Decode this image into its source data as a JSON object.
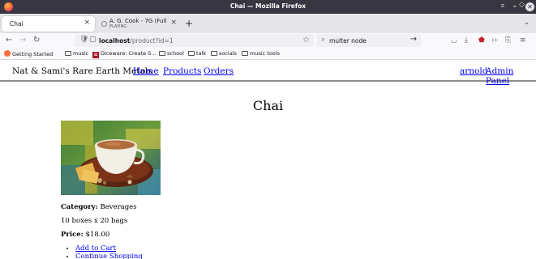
{
  "window": {
    "title": "Chai — Mozilla Firefox",
    "controls": [
      "minimize",
      "restore",
      "close"
    ]
  },
  "tabs": [
    {
      "label": "Chai",
      "active": true
    },
    {
      "label": "A. G. Cook - 7G (Full Alb",
      "subtitle": "PLAYING",
      "active": false
    }
  ],
  "navigation": {
    "url_host": "localhost",
    "url_path": "/product?id=1",
    "search_value": "multer node"
  },
  "bookmarks": [
    {
      "label": "Getting Started",
      "icon": "firefox-icon"
    },
    {
      "label": "music",
      "icon": "folder-icon"
    },
    {
      "label": "Diceware: Create S...",
      "icon": "diceware-icon"
    },
    {
      "label": "school",
      "icon": "folder-icon"
    },
    {
      "label": "talk",
      "icon": "folder-icon"
    },
    {
      "label": "socials",
      "icon": "folder-icon"
    },
    {
      "label": "music tools",
      "icon": "folder-icon"
    }
  ],
  "site": {
    "brand": "Nat & Sami's Rare Earth Metals",
    "nav": [
      "Home",
      "Products",
      "Orders"
    ],
    "user": "arnold",
    "admin": "Admin Panel"
  },
  "product": {
    "name": "Chai",
    "category_label": "Category:",
    "category": "Beverages",
    "quantity": "10 boxes x 20 bags",
    "price_label": "Price:",
    "price": "$18.00",
    "actions": [
      "Add to Cart",
      "Continue Shopping"
    ]
  },
  "colors": {
    "titlebar": "#383640",
    "link": "#0000ee",
    "firefox_accent": "#ff7139"
  }
}
